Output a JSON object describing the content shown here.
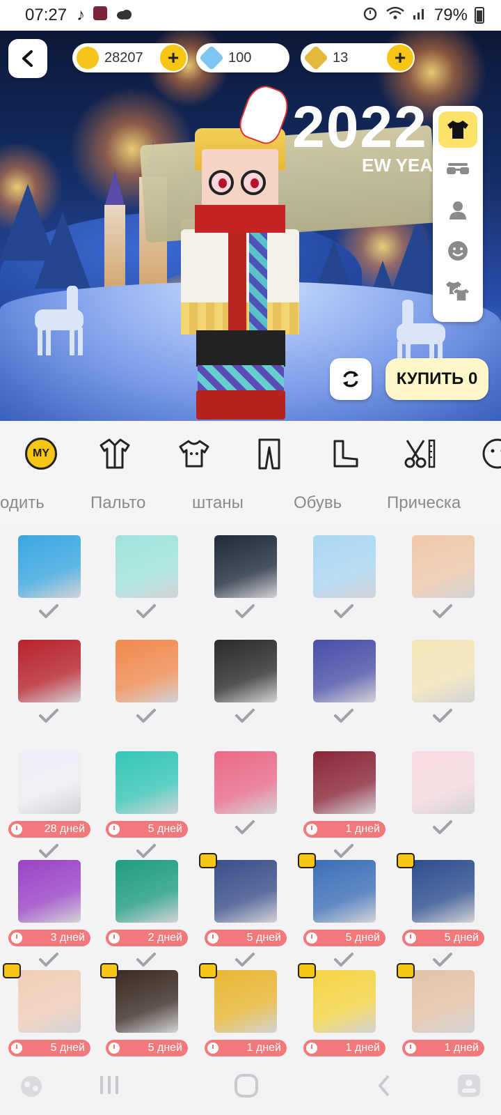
{
  "status_bar": {
    "time": "07:27",
    "battery": "79%"
  },
  "currencies": [
    {
      "name": "gold-coins",
      "value": "28207",
      "color": "#f5c518",
      "has_plus": true
    },
    {
      "name": "diamonds",
      "value": "100",
      "color": "#7cc6ef",
      "has_plus": false
    },
    {
      "name": "gold-cubes",
      "value": "13",
      "color": "#e3b93c",
      "has_plus": true
    }
  ],
  "banner": {
    "year": "2022",
    "subtitle": "EW YEA"
  },
  "buy_button_label": "КУПИТЬ 0",
  "side_tabs": [
    "shirt-icon",
    "glasses-icon",
    "person-icon",
    "smile-icon",
    "outfits-icon"
  ],
  "categories": [
    {
      "icon": "my-badge-icon",
      "badge": "MY",
      "label": "одить"
    },
    {
      "icon": "coat-icon",
      "label": "Пальто"
    },
    {
      "icon": "tshirt-icon",
      "label": "штаны"
    },
    {
      "icon": "pants-icon",
      "label": "Обувь"
    },
    {
      "icon": "boot-icon",
      "label": "Прическа"
    },
    {
      "icon": "scissors-icon",
      "label": ""
    },
    {
      "icon": "face-icon",
      "label": ""
    }
  ],
  "items": [
    {
      "name": "blue-cap-hair",
      "color": "#3aa7e0",
      "days": ""
    },
    {
      "name": "sneakers-white",
      "color": "#9fe3dc",
      "days": ""
    },
    {
      "name": "black-outfit",
      "color": "#1e2a3a",
      "days": ""
    },
    {
      "name": "blue-hoodie",
      "color": "#a9d6f3",
      "days": ""
    },
    {
      "name": "ninja-mask-face",
      "color": "#f0c7a8",
      "days": ""
    },
    {
      "name": "red-dress",
      "color": "#b8222b",
      "days": ""
    },
    {
      "name": "orange-hair",
      "color": "#f08a4e",
      "days": ""
    },
    {
      "name": "black-shoes",
      "color": "#2a2a2a",
      "days": ""
    },
    {
      "name": "checkered-skirt",
      "color": "#4a4fa8",
      "days": ""
    },
    {
      "name": "gold-coat",
      "color": "#f4e6b8",
      "days": ""
    },
    {
      "name": "white-hair",
      "color": "#eeeef6",
      "days": "28 дней"
    },
    {
      "name": "gold-sneakers",
      "color": "#35c7b5",
      "days": "5 дней"
    },
    {
      "name": "pink-pants",
      "color": "#ea6a88",
      "days": ""
    },
    {
      "name": "maroon-pants",
      "color": "#8a2638",
      "days": "1 дней"
    },
    {
      "name": "pink-shirt",
      "color": "#f7dbe0",
      "days": ""
    },
    {
      "name": "purple-top",
      "color": "#9a44c6",
      "days": "3 дней"
    },
    {
      "name": "green-jacket",
      "color": "#1e9d82",
      "days": "2 дней"
    },
    {
      "name": "blue-shoes",
      "color": "#3a4e8a",
      "days": "5 дней"
    },
    {
      "name": "blue-skirt",
      "color": "#3c6fb8",
      "days": "5 дней"
    },
    {
      "name": "blue-coat",
      "color": "#2c4e8e",
      "days": "5 дней"
    },
    {
      "name": "red-eyes-face",
      "color": "#f2cdb8",
      "days": "5 дней"
    },
    {
      "name": "dark-hair",
      "color": "#3a2a22",
      "days": "5 дней"
    },
    {
      "name": "gold-sandals",
      "color": "#e8b733",
      "days": "1 дней"
    },
    {
      "name": "banana-costume",
      "color": "#f4d442",
      "days": "1 дней"
    },
    {
      "name": "surprised-face",
      "color": "#e4c2a6",
      "days": "1 дней"
    }
  ],
  "item_badges": [
    false,
    false,
    false,
    false,
    false,
    false,
    false,
    false,
    false,
    false,
    false,
    false,
    false,
    false,
    false,
    false,
    false,
    true,
    true,
    true,
    true,
    true,
    true,
    true,
    true
  ]
}
